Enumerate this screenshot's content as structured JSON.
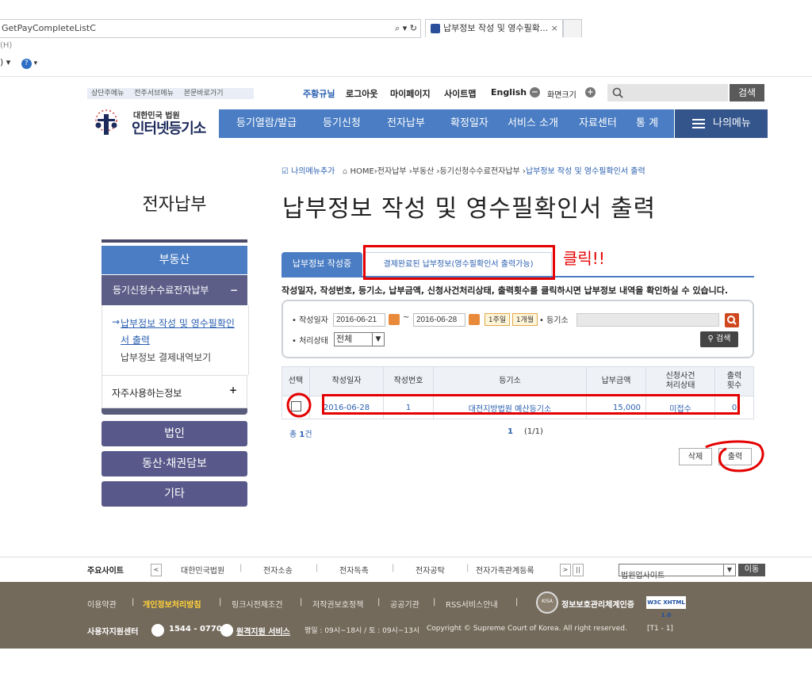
{
  "browser": {
    "url": "GetPayCompleteListC",
    "address_controls": "⌕ ▾ ↻",
    "tab_title": "납부정보 작성 및 영수필확...",
    "tab_close": "×",
    "menu_fragment": "(H)",
    "toolbar_fragment": ") ▾",
    "help_icon": "?"
  },
  "skip_links": [
    "상단주메뉴",
    "전주서브메뉴",
    "본문바로가기"
  ],
  "util": {
    "guide": "주황규닐",
    "logout": "로그아웃",
    "mypage": "마이페이지",
    "sitemap": "사이트맵",
    "english": "English",
    "zoom_label": "화면크기",
    "zoom_minus": "−",
    "zoom_plus": "+",
    "search_button": "검색"
  },
  "logo": {
    "small": "대한민국 법원",
    "big": "인터넷등기소"
  },
  "gnb": {
    "items": [
      "등기열람/발급",
      "등기신청",
      "전자납부",
      "확정일자",
      "서비스 소개",
      "자료센터",
      "통 계"
    ],
    "mymenu": "나의메뉴"
  },
  "breadcrumb": {
    "add": "나의메뉴추가",
    "home": "HOME",
    "path": "›전자납부 ›부동산 ›등기신청수수료전자납부 ›",
    "current": "납부정보 작성 및 영수필확인서 출력"
  },
  "page_title": "납부정보 작성 및 영수필확인서 출력",
  "sidebar": {
    "title": "전자납부",
    "realestate": "부동산",
    "sub_header": "등기신청수수료전자납부",
    "sub_toggle": "−",
    "link1_line1": "납부정보 작성 및 영수필확인",
    "link1_line2": "서 출력",
    "link1_arrow": "→",
    "link2": "납부정보 결제내역보기",
    "fav": "자주사용하는정보",
    "fav_toggle": "+",
    "corp": "법인",
    "movable": "동산·채권담보",
    "etc": "기타"
  },
  "tabs": {
    "writing": "납부정보 작성중",
    "complete": "결제완료된 납부정보(영수필확인서 출력가능)"
  },
  "annotation": {
    "click": "클릭!!",
    "color": "#e40000"
  },
  "description": "작성일자, 작성번호, 등기소, 납부금액, 신청사건처리상태, 출력횟수를 클릭하시면 납부정보 내역을 확인하실 수 있습니다.",
  "filter": {
    "date_label": "• 작성일자",
    "date_from": "2016-06-21",
    "tilde": "~",
    "date_to": "2016-06-28",
    "week": "1주일",
    "month": "1개월",
    "registry_label": "• 등기소",
    "status_label": "• 처리상태",
    "status_value": "전체",
    "search_button": "검색"
  },
  "table": {
    "headers": {
      "select": "선택",
      "date": "작성일자",
      "number": "작성번호",
      "registry": "등기소",
      "amount": "납부금액",
      "status_1": "신청사건",
      "status_2": "처리상태",
      "count_1": "출력",
      "count_2": "횟수"
    },
    "rows": [
      {
        "date": "2016-06-28",
        "number": "1",
        "registry": "대전지방법원 예산등기소",
        "amount": "15,000",
        "status": "미접수",
        "count": "0"
      }
    ]
  },
  "total": {
    "prefix": "총",
    "value": "1",
    "unit": "건"
  },
  "pager": {
    "current": "1",
    "info": "(1/1)"
  },
  "buttons": {
    "delete": "삭제",
    "print": "출력"
  },
  "footer": {
    "sites_label": "주요사이트",
    "sites": [
      "대한민국법원",
      "전자소송",
      "전자독촉",
      "전자공탁",
      "전자가족관계등록"
    ],
    "prev": "<",
    "next": ">",
    "pause": "||",
    "select": "법원업사이트",
    "go": "이동",
    "links": [
      "이용약관",
      "개인정보처리방침",
      "링크시전제조건",
      "저작권보호정책",
      "공공기관",
      "RSS서비스안내"
    ],
    "isms": "정보보호관리체계인증",
    "w3c": "W3C XHTML 1.0",
    "kisa": "KISA",
    "center": "사용자지원센터",
    "phone": "1544 - 0770",
    "remote": "원격지원 서비스",
    "hours": "평일 : 09시~18시 / 토 : 09시~13시",
    "copyright": "Copyright © Supreme Court of Korea. All right reserved.",
    "code": "[T1 - 1]"
  }
}
